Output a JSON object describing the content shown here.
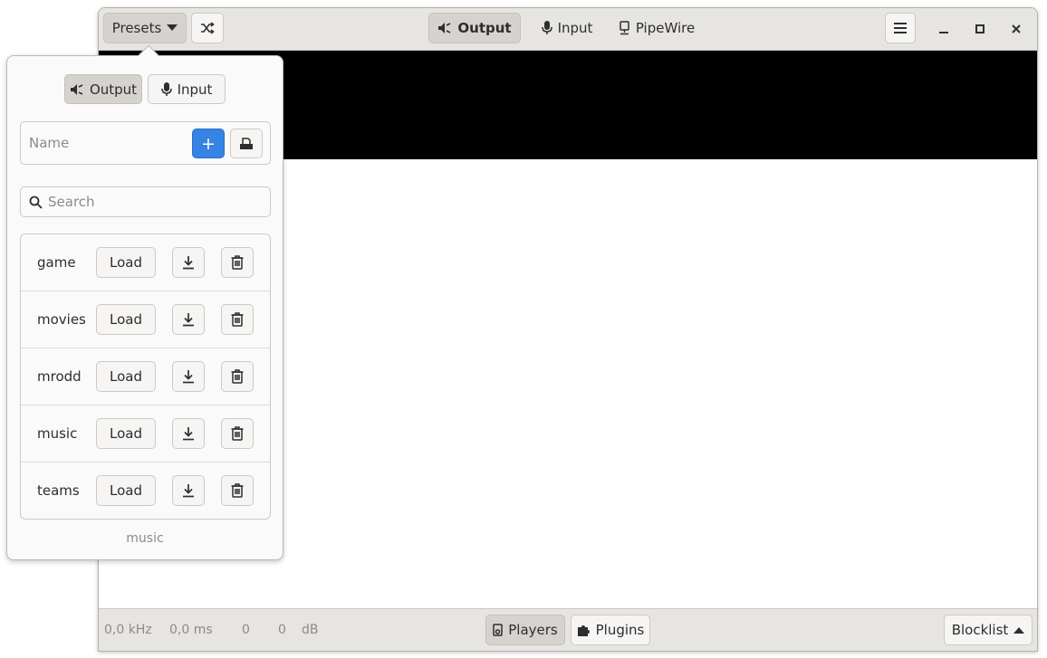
{
  "header": {
    "presets_label": "Presets",
    "tabs": [
      {
        "label": "Output",
        "icon": "speaker-icon",
        "active": true
      },
      {
        "label": "Input",
        "icon": "microphone-icon",
        "active": false
      },
      {
        "label": "PipeWire",
        "icon": "pipewire-icon",
        "active": false
      }
    ]
  },
  "statusbar": {
    "sample_rate": "0,0 kHz",
    "latency": "0,0 ms",
    "level_left": "0",
    "level_right": "0",
    "level_unit": "dB",
    "players_label": "Players",
    "plugins_label": "Plugins",
    "blocklist_label": "Blocklist"
  },
  "popover": {
    "tabs": [
      {
        "label": "Output",
        "active": true
      },
      {
        "label": "Input",
        "active": false
      }
    ],
    "name_placeholder": "Name",
    "add_button_label": "+",
    "search_placeholder": "Search",
    "load_label": "Load",
    "presets": [
      {
        "name": "game"
      },
      {
        "name": "movies"
      },
      {
        "name": "mrodd"
      },
      {
        "name": "music"
      },
      {
        "name": "teams"
      }
    ],
    "current_preset": "music"
  },
  "colors": {
    "accent": "#3584e4",
    "headerbar": "#e7e5e2",
    "active_button": "#d6d3cf"
  }
}
